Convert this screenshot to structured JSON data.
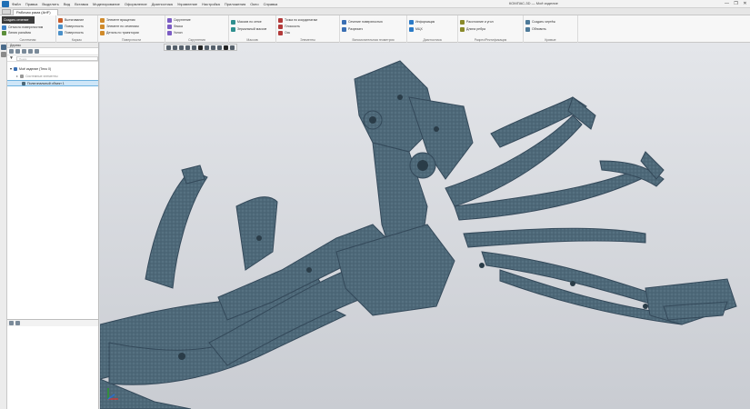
{
  "app": {
    "menu_items": [
      "Файл",
      "Правка",
      "Выделить",
      "Вид",
      "Вставка",
      "Моделирование",
      "Оформление",
      "Диагностика",
      "Управление",
      "Настройка",
      "Приложения",
      "Окно",
      "Справка"
    ],
    "title": "КОМПАС-3D — Моё изделие",
    "window_buttons": [
      "—",
      "❐",
      "✕"
    ]
  },
  "tabs": {
    "document_tab": "Рабочая рама (ArtF)"
  },
  "ribbon": {
    "first_button": "Создать сечение",
    "groups": [
      {
        "label": "Системная",
        "items": [
          "Сетка по поверхностям",
          "Линия разъёма"
        ]
      },
      {
        "label": "Каркас",
        "items": [
          "Вытягивание",
          "Поверхность",
          "Поверхность"
        ]
      },
      {
        "label": "Поверхности",
        "items": [
          "Элемент вращения",
          "Элемент по сечениям",
          "Деталь по траектории"
        ]
      },
      {
        "label": "Скругления",
        "items": [
          "Скругление",
          "Фаска",
          "Уклон"
        ]
      },
      {
        "label": "Массив",
        "items": [
          "Массив по сетке",
          "Зеркальный массив"
        ]
      },
      {
        "label": "Элементы",
        "items": [
          "Точка по координатам",
          "Плоскость",
          "Ось"
        ]
      },
      {
        "label": "Вспомогательная геометрия",
        "items": [
          "Сечение поверхностью",
          "Разрезать"
        ]
      },
      {
        "label": "Диагностика",
        "items": [
          "Информация",
          "МЦХ"
        ]
      },
      {
        "label": "Разрез/Ректификация",
        "items": [
          "Расстояние и угол",
          "Длина ребра"
        ]
      },
      {
        "label": "Кривые",
        "items": [
          "Создать чертёж",
          "Обновить"
        ]
      }
    ]
  },
  "tree": {
    "title": "Дерево",
    "filter_placeholder": "Поиск",
    "rows": [
      {
        "label": "Моё изделие (Тело 0)",
        "indent": 0
      },
      {
        "label": "Системные элементы",
        "indent": 1
      },
      {
        "label": "Полигональный объект 1",
        "indent": 2
      }
    ],
    "selected_index": 2
  },
  "viewport": {
    "model_color": "#4d6878",
    "background_top": "#e4e6ea",
    "background_bottom": "#c9ccd2"
  }
}
